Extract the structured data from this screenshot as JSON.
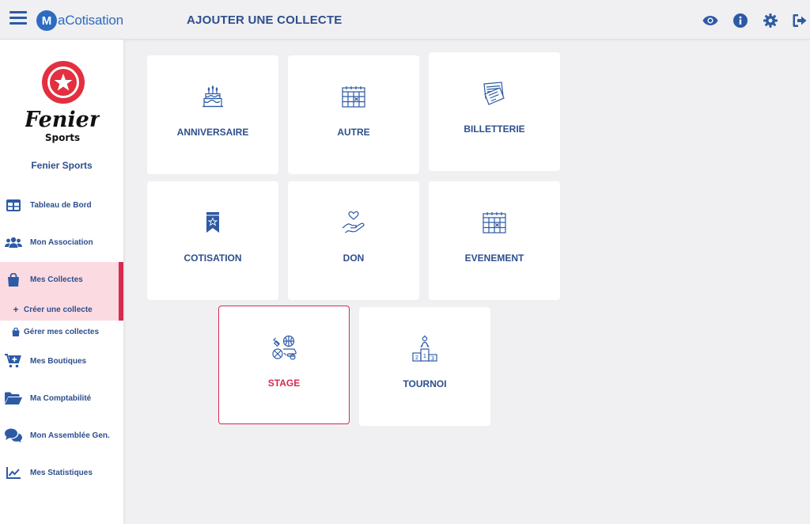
{
  "app": {
    "logo_letter": "M",
    "logo_text": "aCotisation"
  },
  "header": {
    "title": "AJOUTER UNE COLLECTE"
  },
  "top_icons": [
    "eye-icon",
    "info-icon",
    "gear-icon",
    "logout-icon"
  ],
  "organization": {
    "logo_line1": "Fenier",
    "logo_line2": "Sports",
    "name": "Fenier Sports"
  },
  "sidebar": {
    "items": [
      {
        "label": "Tableau de Bord",
        "icon": "dashboard-icon"
      },
      {
        "label": "Mon Association",
        "icon": "users-icon"
      },
      {
        "label": "Mes Collectes",
        "icon": "shopping-bag-icon"
      },
      {
        "label": "Mes Boutiques",
        "icon": "cart-icon"
      },
      {
        "label": "Ma Comptabilité",
        "icon": "folder-icon"
      },
      {
        "label": "Mon Assemblée Gen.",
        "icon": "comments-icon"
      },
      {
        "label": "Mes Statistiques",
        "icon": "chart-icon"
      }
    ],
    "sub_items": [
      {
        "label": "Créer une collecte",
        "icon": "plus-icon",
        "glyph": "+"
      },
      {
        "label": "Gérer mes collectes",
        "icon": "bag-icon"
      }
    ],
    "active": "Mes Collectes"
  },
  "cards": [
    {
      "label": "ANNIVERSAIRE",
      "icon": "cake-icon"
    },
    {
      "label": "AUTRE",
      "icon": "calendar-grid-icon"
    },
    {
      "label": "BILLETTERIE",
      "icon": "tickets-icon"
    },
    {
      "label": "COTISATION",
      "icon": "bookmark-star-icon"
    },
    {
      "label": "DON",
      "icon": "heart-hand-icon"
    },
    {
      "label": "EVENEMENT",
      "icon": "calendar-icon"
    },
    {
      "label": "STAGE",
      "icon": "sports-balls-icon"
    },
    {
      "label": "TOURNOI",
      "icon": "podium-icon"
    }
  ],
  "selected_card": "STAGE",
  "colors": {
    "primary": "#2d4f8c",
    "accent": "#d62a4f",
    "active_bg": "#fbdbe1",
    "background": "#f0eff1"
  }
}
